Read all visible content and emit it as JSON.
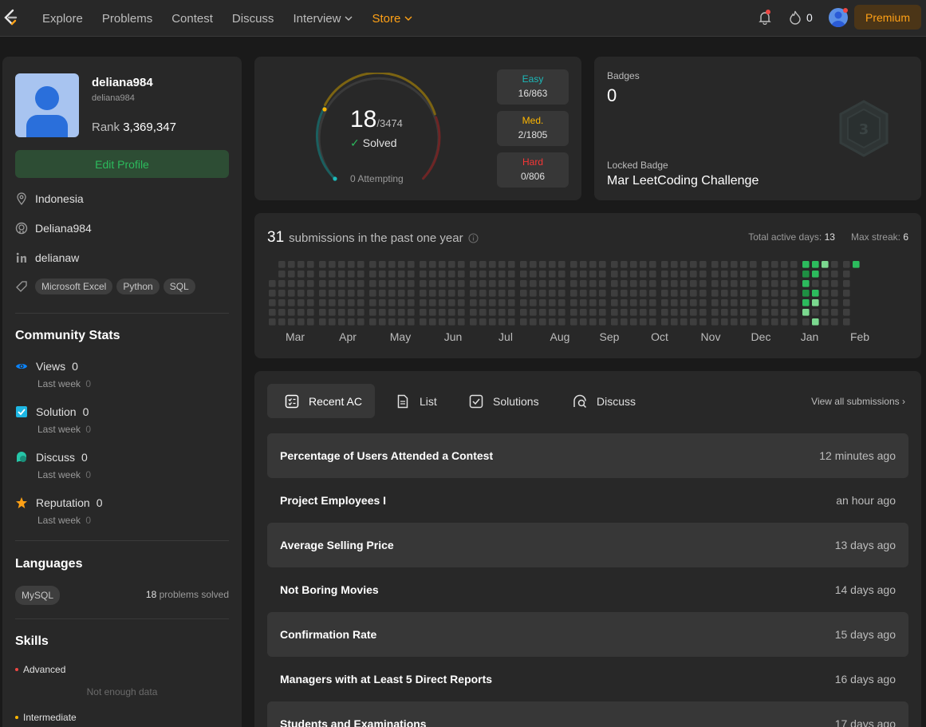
{
  "nav": {
    "links": [
      "Explore",
      "Problems",
      "Contest",
      "Discuss",
      "Interview",
      "Store"
    ],
    "streak": "0",
    "premium": "Premium"
  },
  "profile": {
    "username": "deliana984",
    "realname": "deliana984",
    "rank_label": "Rank",
    "rank_value": "3,369,347",
    "edit_label": "Edit Profile",
    "location": "Indonesia",
    "github": "Deliana984",
    "linkedin": "delianaw",
    "skills_tags": [
      "Microsoft Excel",
      "Python",
      "SQL"
    ]
  },
  "community": {
    "title": "Community Stats",
    "last_week_label": "Last week",
    "items": [
      {
        "label": "Views",
        "value": "0",
        "last_week": "0",
        "icon": "eye-icon",
        "color": "#0a84ff"
      },
      {
        "label": "Solution",
        "value": "0",
        "last_week": "0",
        "icon": "solution-icon",
        "color": "#1eb7e4"
      },
      {
        "label": "Discuss",
        "value": "0",
        "last_week": "0",
        "icon": "discuss-icon",
        "color": "#26c6a8"
      },
      {
        "label": "Reputation",
        "value": "0",
        "last_week": "0",
        "icon": "star-icon",
        "color": "#ffa116"
      }
    ]
  },
  "languages": {
    "title": "Languages",
    "name": "MySQL",
    "count": "18",
    "suffix": "problems solved"
  },
  "skills": {
    "title": "Skills",
    "advanced": "Advanced",
    "no_data": "Not enough data",
    "intermediate": "Intermediate"
  },
  "solved": {
    "count": "18",
    "total": "/3474",
    "label": "Solved",
    "attempting": "0 Attempting",
    "difficulties": [
      {
        "name": "Easy",
        "value": "16/863",
        "color": "#1cbaba"
      },
      {
        "name": "Med.",
        "value": "2/1805",
        "color": "#ffb700"
      },
      {
        "name": "Hard",
        "value": "0/806",
        "color": "#f63737"
      }
    ]
  },
  "badges": {
    "label": "Badges",
    "count": "0",
    "locked_label": "Locked Badge",
    "locked_name": "Mar LeetCoding Challenge"
  },
  "heatmap": {
    "count": "31",
    "text": "submissions in the past one year",
    "active_days_label": "Total active days:",
    "active_days": "13",
    "max_streak_label": "Max streak:",
    "max_streak": "6",
    "months": [
      "Mar",
      "Apr",
      "May",
      "Jun",
      "Jul",
      "Aug",
      "Sep",
      "Oct",
      "Nov",
      "Dec",
      "Jan",
      "Feb"
    ]
  },
  "recent": {
    "tabs": [
      "Recent AC",
      "List",
      "Solutions",
      "Discuss"
    ],
    "view_all": "View all submissions",
    "rows": [
      {
        "title": "Percentage of Users Attended a Contest",
        "time": "12 minutes ago"
      },
      {
        "title": "Project Employees I",
        "time": "an hour ago"
      },
      {
        "title": "Average Selling Price",
        "time": "13 days ago"
      },
      {
        "title": "Not Boring Movies",
        "time": "14 days ago"
      },
      {
        "title": "Confirmation Rate",
        "time": "15 days ago"
      },
      {
        "title": "Managers with at Least 5 Direct Reports",
        "time": "16 days ago"
      },
      {
        "title": "Students and Examinations",
        "time": "17 days ago"
      }
    ]
  }
}
